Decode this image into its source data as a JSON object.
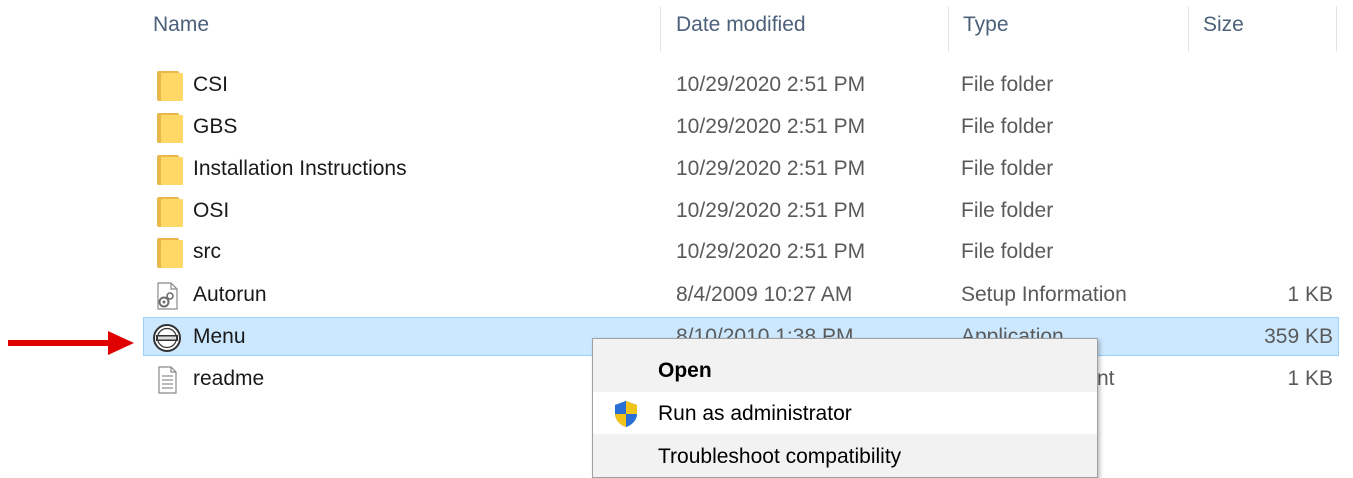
{
  "columns": {
    "name": "Name",
    "date": "Date modified",
    "type": "Type",
    "size": "Size"
  },
  "files": [
    {
      "name": "CSI",
      "date": "10/29/2020 2:51 PM",
      "type": "File folder",
      "size": "",
      "icon": "folder-icon"
    },
    {
      "name": "GBS",
      "date": "10/29/2020 2:51 PM",
      "type": "File folder",
      "size": "",
      "icon": "folder-icon"
    },
    {
      "name": "Installation Instructions",
      "date": "10/29/2020 2:51 PM",
      "type": "File folder",
      "size": "",
      "icon": "folder-icon"
    },
    {
      "name": "OSI",
      "date": "10/29/2020 2:51 PM",
      "type": "File folder",
      "size": "",
      "icon": "folder-icon"
    },
    {
      "name": "src",
      "date": "10/29/2020 2:51 PM",
      "type": "File folder",
      "size": "",
      "icon": "folder-icon"
    },
    {
      "name": "Autorun",
      "date": "8/4/2009 10:27 AM",
      "type": "Setup Information",
      "size": "1 KB",
      "icon": "setup-info-icon"
    },
    {
      "name": "Menu",
      "date": "8/10/2010 1:38 PM",
      "type": "Application",
      "size": "359 KB",
      "icon": "application-icon",
      "selected": true
    },
    {
      "name": "readme",
      "date": "",
      "type": "nt",
      "size": "1 KB",
      "icon": "text-document-icon"
    }
  ],
  "context_menu": {
    "items": [
      {
        "label": "Open",
        "bold": true
      },
      {
        "label": "Run as administrator",
        "icon": "uac-shield-icon",
        "hover": true
      },
      {
        "label": "Troubleshoot compatibility"
      }
    ]
  },
  "colors": {
    "selection_bg": "#cce8ff",
    "selection_border": "#99d1ff",
    "arrow": "#e00000",
    "header_text": "#4c607a"
  }
}
